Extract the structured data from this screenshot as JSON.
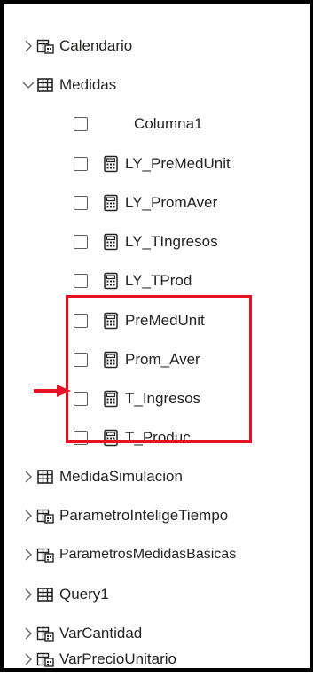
{
  "tree": {
    "tables": [
      {
        "label": "Calendario",
        "icon": "calendar-table-icon",
        "expanded": false
      },
      {
        "label": "Medidas",
        "icon": "table-icon",
        "expanded": true,
        "children": [
          {
            "label": "Columna1",
            "checked": false,
            "icon": "none"
          },
          {
            "label": "LY_PreMedUnit",
            "checked": false,
            "icon": "calculator-icon"
          },
          {
            "label": "LY_PromAver",
            "checked": false,
            "icon": "calculator-icon"
          },
          {
            "label": "LY_TIngresos",
            "checked": false,
            "icon": "calculator-icon"
          },
          {
            "label": "LY_TProd",
            "checked": false,
            "icon": "calculator-icon"
          },
          {
            "label": "PreMedUnit",
            "checked": false,
            "icon": "calculator-icon"
          },
          {
            "label": "Prom_Aver",
            "checked": false,
            "icon": "calculator-icon"
          },
          {
            "label": "T_Ingresos",
            "checked": false,
            "icon": "calculator-icon"
          },
          {
            "label": "T_Produc",
            "checked": false,
            "icon": "calculator-icon"
          }
        ]
      },
      {
        "label": "MedidaSimulacion",
        "icon": "table-icon",
        "expanded": false
      },
      {
        "label": "ParametroInteligeTiempo",
        "icon": "calendar-table-icon",
        "expanded": false
      },
      {
        "label": "ParametrosMedidasBasicas",
        "icon": "calendar-table-icon",
        "expanded": false
      },
      {
        "label": "Query1",
        "icon": "table-icon",
        "expanded": false
      },
      {
        "label": "VarCantidad",
        "icon": "calendar-table-icon",
        "expanded": false
      },
      {
        "label": "VarPrecioUnitario",
        "icon": "calendar-table-icon",
        "expanded": false
      }
    ]
  },
  "colors": {
    "highlight": "#e81123",
    "arrow": "#e81123",
    "frame": "#000000",
    "text": "#252423"
  }
}
